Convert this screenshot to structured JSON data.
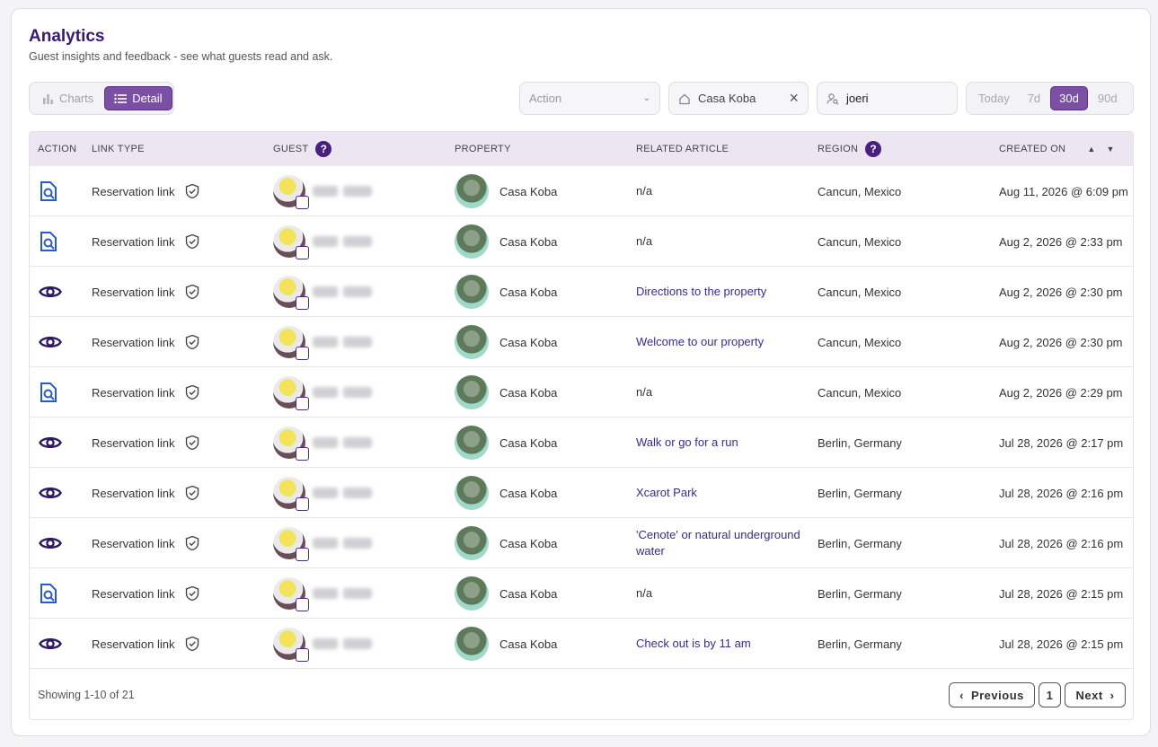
{
  "header": {
    "title": "Analytics",
    "subtitle": "Guest insights and feedback - see what guests read and ask."
  },
  "view_toggle": {
    "charts_label": "Charts",
    "detail_label": "Detail",
    "active": "detail"
  },
  "filters": {
    "action_placeholder": "Action",
    "property_value": "Casa Koba",
    "guest_value": "joeri"
  },
  "date_range": {
    "options": [
      "Today",
      "7d",
      "30d",
      "90d"
    ],
    "active": "30d"
  },
  "table": {
    "columns": {
      "action": "ACTION",
      "link_type": "LINK TYPE",
      "guest": "GUEST",
      "property": "PROPERTY",
      "related_article": "RELATED ARTICLE",
      "region": "REGION",
      "created_on": "CREATED ON"
    },
    "rows": [
      {
        "action_icon": "search-doc-icon",
        "link_type": "Reservation link",
        "property": "Casa Koba",
        "article": "n/a",
        "region": "Cancun, Mexico",
        "created": "Aug 11, 2026 @ 6:09 pm"
      },
      {
        "action_icon": "search-doc-icon",
        "link_type": "Reservation link",
        "property": "Casa Koba",
        "article": "n/a",
        "region": "Cancun, Mexico",
        "created": "Aug 2, 2026 @ 2:33 pm"
      },
      {
        "action_icon": "eye-icon",
        "link_type": "Reservation link",
        "property": "Casa Koba",
        "article": "Directions to the property",
        "region": "Cancun, Mexico",
        "created": "Aug 2, 2026 @ 2:30 pm"
      },
      {
        "action_icon": "eye-icon",
        "link_type": "Reservation link",
        "property": "Casa Koba",
        "article": "Welcome to our property",
        "region": "Cancun, Mexico",
        "created": "Aug 2, 2026 @ 2:30 pm"
      },
      {
        "action_icon": "search-doc-icon",
        "link_type": "Reservation link",
        "property": "Casa Koba",
        "article": "n/a",
        "region": "Cancun, Mexico",
        "created": "Aug 2, 2026 @ 2:29 pm"
      },
      {
        "action_icon": "eye-icon",
        "link_type": "Reservation link",
        "property": "Casa Koba",
        "article": "Walk or go for a run",
        "region": "Berlin, Germany",
        "created": "Jul 28, 2026 @ 2:17 pm"
      },
      {
        "action_icon": "eye-icon",
        "link_type": "Reservation link",
        "property": "Casa Koba",
        "article": "Xcarot Park",
        "region": "Berlin, Germany",
        "created": "Jul 28, 2026 @ 2:16 pm"
      },
      {
        "action_icon": "eye-icon",
        "link_type": "Reservation link",
        "property": "Casa Koba",
        "article": "'Cenote' or natural underground water",
        "region": "Berlin, Germany",
        "created": "Jul 28, 2026 @ 2:16 pm"
      },
      {
        "action_icon": "search-doc-icon",
        "link_type": "Reservation link",
        "property": "Casa Koba",
        "article": "n/a",
        "region": "Berlin, Germany",
        "created": "Jul 28, 2026 @ 2:15 pm"
      },
      {
        "action_icon": "eye-icon",
        "link_type": "Reservation link",
        "property": "Casa Koba",
        "article": "Check out is by 11 am",
        "region": "Berlin, Germany",
        "created": "Jul 28, 2026 @ 2:15 pm"
      }
    ]
  },
  "footer": {
    "showing": "Showing 1-10 of 21",
    "previous": "Previous",
    "page": "1",
    "next": "Next"
  },
  "colors": {
    "accent": "#7b4fa3",
    "header_bg": "#ece6f2",
    "link_text": "#3b2a8f",
    "icon": "#2d1a66"
  }
}
